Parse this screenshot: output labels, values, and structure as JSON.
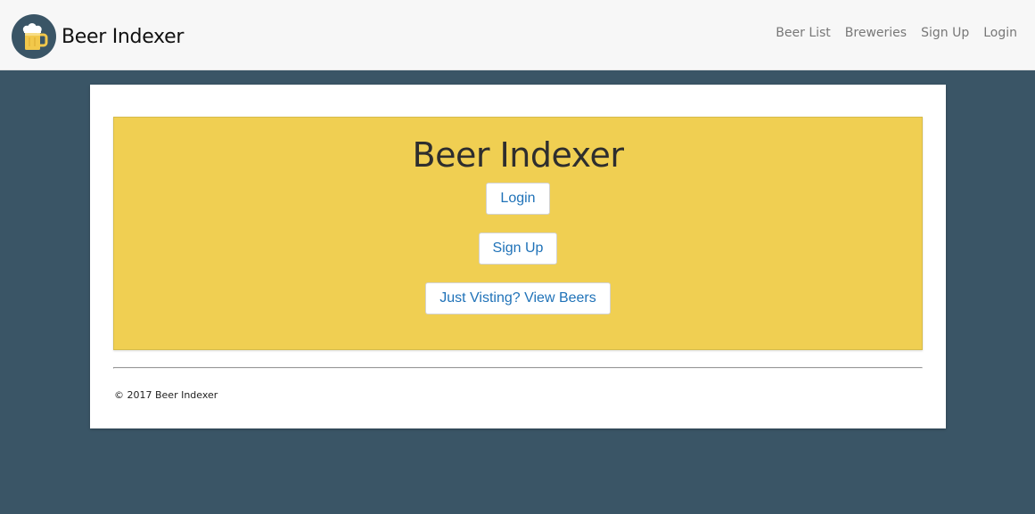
{
  "navbar": {
    "brand": "Beer Indexer",
    "logo_icon": "beer-mug-icon",
    "links": [
      "Beer List",
      "Breweries",
      "Sign Up",
      "Login"
    ]
  },
  "jumbotron": {
    "title": "Beer Indexer",
    "buttons": {
      "login": "Login",
      "signup": "Sign Up",
      "visit": "Just Visting? View Beers"
    }
  },
  "footer": {
    "text": "© 2017 Beer Indexer"
  },
  "colors": {
    "page_bg": "#3a5566",
    "navbar_bg": "#f7f7f7",
    "jumbotron_bg": "#f0cf52",
    "button_text": "#1f72b8"
  }
}
